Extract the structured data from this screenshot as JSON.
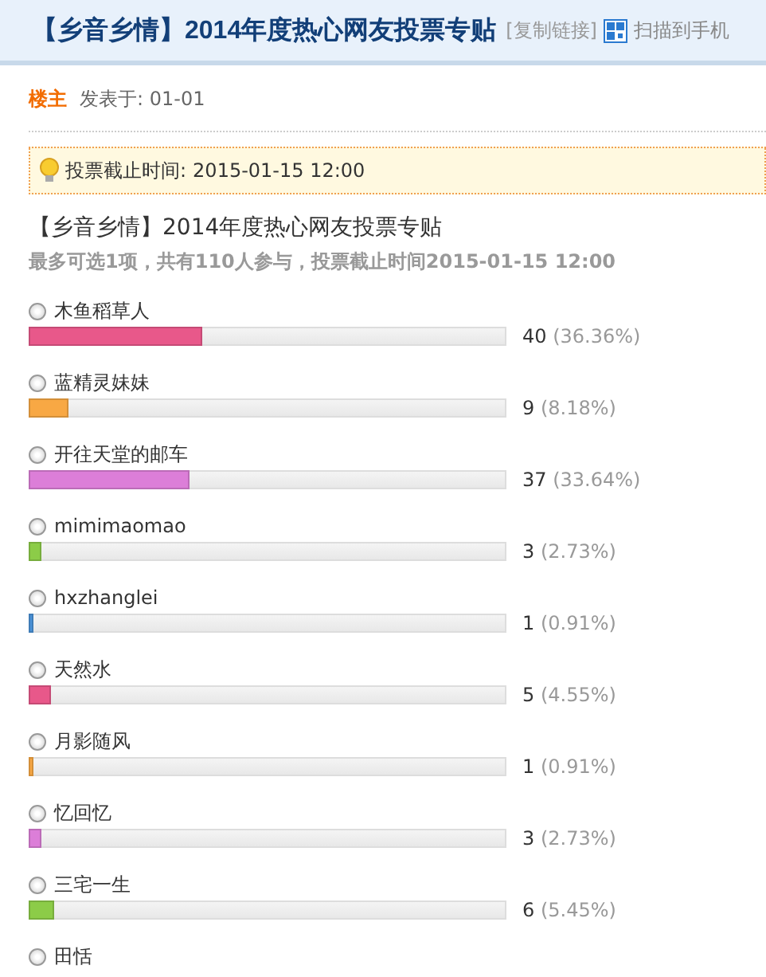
{
  "header": {
    "title": "【乡音乡情】2014年度热心网友投票专贴",
    "copy_link": "[复制链接]",
    "scan": "扫描到手机"
  },
  "post": {
    "author": "楼主",
    "posted": "发表于: 01-01"
  },
  "notice": {
    "label": "投票截止时间:",
    "time": "2015-01-15 12:00"
  },
  "poll": {
    "title": "【乡音乡情】2014年度热心网友投票专贴",
    "summary": "最多可选1项，共有110人参与，投票截止时间2015-01-15 12:00",
    "options": [
      {
        "label": "木鱼稻草人",
        "selected": false,
        "level": 0.3636,
        "color": "#e8588a",
        "count": "40",
        "percent": "(36.36%)"
      },
      {
        "label": "蓝精灵妹妹",
        "selected": false,
        "level": 0.0818,
        "color": "#f8a844",
        "count": "9",
        "percent": "(8.18%)"
      },
      {
        "label": "开往天堂的邮车",
        "selected": false,
        "level": 0.3364,
        "color": "#dc7ed8",
        "count": "37",
        "percent": "(33.64%)"
      },
      {
        "label": "mimimaomao",
        "selected": false,
        "level": 0.0273,
        "color": "#8ccc48",
        "count": "3",
        "percent": "(2.73%)"
      },
      {
        "label": "hxzhanglei",
        "selected": false,
        "level": 0.0091,
        "color": "#4a92d8",
        "count": "1",
        "percent": "(0.91%)"
      },
      {
        "label": "天然水",
        "selected": false,
        "level": 0.0455,
        "color": "#e8588a",
        "count": "5",
        "percent": "(4.55%)"
      },
      {
        "label": "月影随风",
        "selected": false,
        "level": 0.0091,
        "color": "#f8a844",
        "count": "1",
        "percent": "(0.91%)"
      },
      {
        "label": "忆回忆",
        "selected": false,
        "level": 0.0273,
        "color": "#dc7ed8",
        "count": "3",
        "percent": "(2.73%)"
      },
      {
        "label": "三宅一生",
        "selected": false,
        "level": 0.0545,
        "color": "#8ccc48",
        "count": "6",
        "percent": "(5.45%)"
      },
      {
        "label": "田恬",
        "selected": false
      }
    ]
  }
}
